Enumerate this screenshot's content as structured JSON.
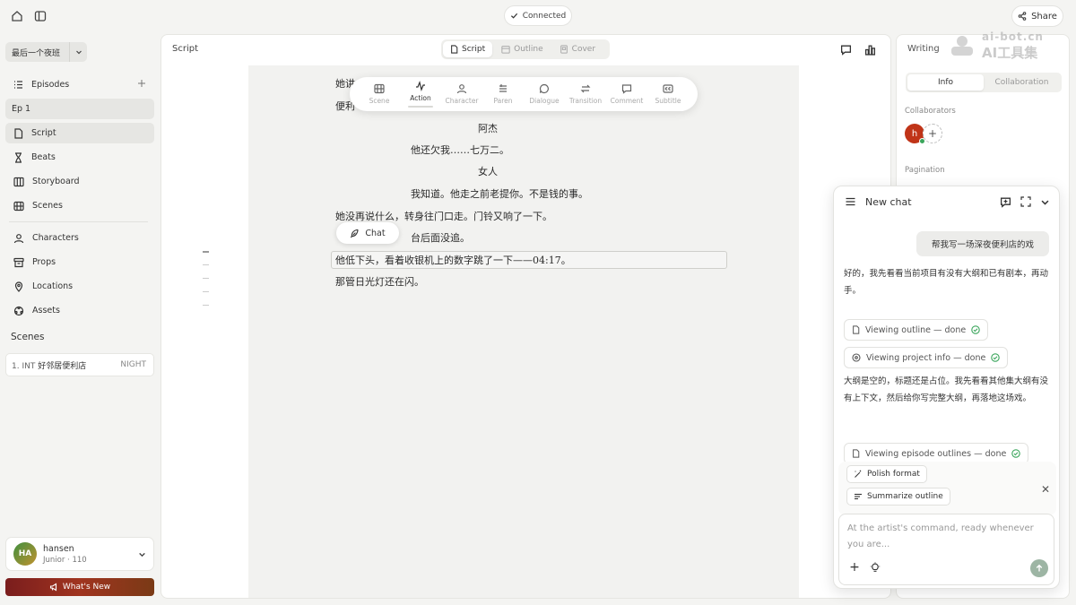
{
  "topbar": {
    "connected_label": "Connected",
    "share_label": "Share"
  },
  "sidebar": {
    "project_name": "最后一个夜班",
    "episodes_label": "Episodes",
    "episode_item": "Ep 1",
    "nav": [
      {
        "label": "Script",
        "icon": "file-icon"
      },
      {
        "label": "Beats",
        "icon": "hourglass-icon"
      },
      {
        "label": "Storyboard",
        "icon": "storyboard-icon"
      },
      {
        "label": "Scenes",
        "icon": "film-icon"
      },
      {
        "label": "Characters",
        "icon": "user-icon"
      },
      {
        "label": "Props",
        "icon": "box-icon"
      },
      {
        "label": "Locations",
        "icon": "pin-icon"
      },
      {
        "label": "Assets",
        "icon": "assets-icon"
      }
    ],
    "scenes_title": "Scenes",
    "scene": {
      "number": "1. INT",
      "name": "好邻居便利店",
      "time": "NIGHT"
    },
    "user": {
      "initials": "HA",
      "name": "hansen",
      "level": "Junior · 110"
    },
    "whats_new": "What's New"
  },
  "editor": {
    "title": "Script",
    "tabs": [
      "Script",
      "Outline",
      "Cover"
    ],
    "toolbar": [
      "Scene",
      "Action",
      "Character",
      "Paren",
      "Dialogue",
      "Transition",
      "Comment",
      "Subtitle"
    ],
    "chat_pill": "Chat",
    "lines": [
      "她讲",
      "便利",
      "阿杰",
      "他还欠我……七万二。",
      "女人",
      "我知道。他走之前老提你。不是钱的事。",
      "她没再说什么，转身往门口走。门铃又响了一下。",
      "台后面没追。",
      "他低下头，看着收银机上的数字跳了一下——04:17。",
      "那管日光灯还在闪。"
    ]
  },
  "writing_panel": {
    "title": "Writing",
    "tabs": [
      "Info",
      "Collaboration"
    ],
    "collaborators_label": "Collaborators",
    "collaborator_initial": "h",
    "pagination_label": "Pagination"
  },
  "watermark": {
    "line1": "ai-bot.cn",
    "line2": "AI工具集"
  },
  "chat": {
    "title": "New chat",
    "user_message": "帮我写一场深夜便利店的戏",
    "bot_message_1": "好的，我先看看当前项目有没有大纲和已有剧本，再动手。",
    "tool_1": "Viewing outline — done",
    "tool_2": "Viewing project info — done",
    "bot_message_2": "大纲是空的，标题还是占位。我先看看其他集大纲有没有上下文，然后给你写完整大纲，再落地这场戏。",
    "tool_3": "Viewing episode outlines — done",
    "suggestions": [
      "Polish format",
      "Summarize outline"
    ],
    "input_placeholder": "At the artist's command, ready whenever you are..."
  }
}
